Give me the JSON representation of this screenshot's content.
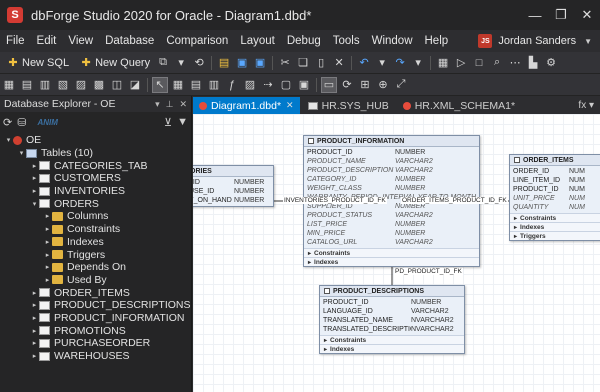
{
  "window": {
    "title": "dbForge Studio 2020 for Oracle - Diagram1.dbd*",
    "logo": "S",
    "controls": [
      "—",
      "❐",
      "✕"
    ]
  },
  "menu": [
    "File",
    "Edit",
    "View",
    "Database",
    "Comparison",
    "Layout",
    "Debug",
    "Tools",
    "Window",
    "Help"
  ],
  "user": {
    "initials": "JS",
    "name": "Jordan Sanders"
  },
  "toolbar1": {
    "new_sql": "New SQL",
    "new_query": "New Query"
  },
  "explorer": {
    "title": "Database Explorer - OE",
    "watermark": "ANIM",
    "tree": [
      {
        "label": "OE",
        "level": 0,
        "icon": "db",
        "twisty": "▾"
      },
      {
        "label": "Tables (10)",
        "level": 1,
        "icon": "tables",
        "twisty": "▾"
      },
      {
        "label": "CATEGORIES_TAB",
        "level": 2,
        "icon": "table",
        "twisty": "▸"
      },
      {
        "label": "CUSTOMERS",
        "level": 2,
        "icon": "table",
        "twisty": "▸"
      },
      {
        "label": "INVENTORIES",
        "level": 2,
        "icon": "table",
        "twisty": "▸"
      },
      {
        "label": "ORDERS",
        "level": 2,
        "icon": "table",
        "twisty": "▾"
      },
      {
        "label": "Columns",
        "level": 3,
        "icon": "folder",
        "twisty": "▸"
      },
      {
        "label": "Constraints",
        "level": 3,
        "icon": "folder",
        "twisty": "▸"
      },
      {
        "label": "Indexes",
        "level": 3,
        "icon": "folder",
        "twisty": "▸"
      },
      {
        "label": "Triggers",
        "level": 3,
        "icon": "folder",
        "twisty": "▸"
      },
      {
        "label": "Depends On",
        "level": 3,
        "icon": "folder",
        "twisty": "▸"
      },
      {
        "label": "Used By",
        "level": 3,
        "icon": "folder",
        "twisty": "▸"
      },
      {
        "label": "ORDER_ITEMS",
        "level": 2,
        "icon": "table",
        "twisty": "▸"
      },
      {
        "label": "PRODUCT_DESCRIPTIONS",
        "level": 2,
        "icon": "table",
        "twisty": "▸"
      },
      {
        "label": "PRODUCT_INFORMATION",
        "level": 2,
        "icon": "table",
        "twisty": "▸"
      },
      {
        "label": "PROMOTIONS",
        "level": 2,
        "icon": "table",
        "twisty": "▸"
      },
      {
        "label": "PURCHASEORDER",
        "level": 2,
        "icon": "table",
        "twisty": "▸"
      },
      {
        "label": "WAREHOUSES",
        "level": 2,
        "icon": "table",
        "twisty": "▸"
      }
    ]
  },
  "tabs": [
    {
      "label": "Diagram1.dbd*",
      "active": true,
      "icon": "dot"
    },
    {
      "label": "HR.SYS_HUB",
      "active": false,
      "icon": "table"
    },
    {
      "label": "HR.XML_SCHEMA1*",
      "active": false,
      "icon": "dot"
    }
  ],
  "tab_end": "fx ▾",
  "diagram": {
    "inventories": {
      "title": "ORIES",
      "columns": [
        {
          "name": "_ID",
          "type": "NUMBER"
        },
        {
          "name": "USE_ID",
          "type": "NUMBER"
        },
        {
          "name": "Y_ON_HAND",
          "type": "NUMBER"
        }
      ]
    },
    "product_information": {
      "title": "PRODUCT_INFORMATION",
      "columns": [
        {
          "name": "PRODUCT_ID",
          "type": "NUMBER",
          "italic": false
        },
        {
          "name": "PRODUCT_NAME",
          "type": "VARCHAR2",
          "italic": true
        },
        {
          "name": "PRODUCT_DESCRIPTION",
          "type": "VARCHAR2",
          "italic": true
        },
        {
          "name": "CATEGORY_ID",
          "type": "NUMBER",
          "italic": true
        },
        {
          "name": "WEIGHT_CLASS",
          "type": "NUMBER",
          "italic": true
        },
        {
          "name": "WARRANTY_PERIOD",
          "type": "INTERVAL YEAR TO MONTH",
          "italic": true
        },
        {
          "name": "SUPPLIER_ID",
          "type": "NUMBER",
          "italic": true
        },
        {
          "name": "PRODUCT_STATUS",
          "type": "VARCHAR2",
          "italic": true
        },
        {
          "name": "LIST_PRICE",
          "type": "NUMBER",
          "italic": true
        },
        {
          "name": "MIN_PRICE",
          "type": "NUMBER",
          "italic": true
        },
        {
          "name": "CATALOG_URL",
          "type": "VARCHAR2",
          "italic": true
        }
      ],
      "sections": [
        "Constraints",
        "Indexes"
      ]
    },
    "order_items": {
      "title": "ORDER_ITEMS",
      "columns": [
        {
          "name": "ORDER_ID",
          "type": "NUM",
          "italic": false
        },
        {
          "name": "LINE_ITEM_ID",
          "type": "NUM",
          "italic": false
        },
        {
          "name": "PRODUCT_ID",
          "type": "NUM",
          "italic": false
        },
        {
          "name": "UNIT_PRICE",
          "type": "NUM",
          "italic": true
        },
        {
          "name": "QUANTITY",
          "type": "NUM",
          "italic": true
        }
      ],
      "sections": [
        "Constraints",
        "Indexes",
        "Triggers"
      ]
    },
    "product_descriptions": {
      "title": "PRODUCT_DESCRIPTIONS",
      "columns": [
        {
          "name": "PRODUCT_ID",
          "type": "NUMBER",
          "italic": false
        },
        {
          "name": "LANGUAGE_ID",
          "type": "VARCHAR2",
          "italic": false
        },
        {
          "name": "TRANSLATED_NAME",
          "type": "NVARCHAR2",
          "italic": false
        },
        {
          "name": "TRANSLATED_DESCRIPTION",
          "type": "NVARCHAR2",
          "italic": false
        }
      ],
      "sections": [
        "Constraints",
        "Indexes"
      ]
    },
    "relations": {
      "inv_fk": "INVENTORIES_PRODUCT_ID_FK",
      "oi_fk": "ORDER_ITEMS_PRODUCT_ID_FK",
      "pd_fk": "PD_PRODUCT_ID_FK"
    }
  }
}
